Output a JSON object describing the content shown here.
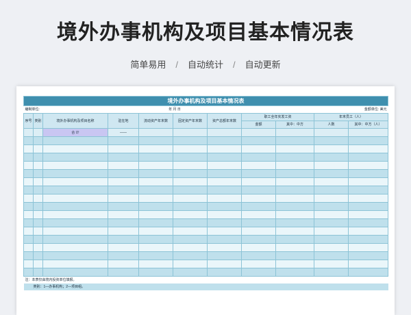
{
  "page": {
    "title": "境外办事机构及项目基本情况表",
    "subtitle_items": [
      "简单易用",
      "自动统计",
      "自动更新"
    ],
    "separator": "/"
  },
  "sheet": {
    "table_title": "境外办事机构及项目基本情况表",
    "unit_label": "编制单位:",
    "date_label": "年 月 日",
    "currency_label": "金额单位: 美元",
    "headers": {
      "seq": "序号",
      "category": "类别",
      "name": "境外办事机构及项目名称",
      "location": "驻在地",
      "current_assets": "流动资产年末数",
      "fixed_assets": "固定资产年末数",
      "total_assets": "资产总额年末数",
      "wage_group": "职工全年实发工资",
      "staff_group": "年末员工（人）",
      "amount": "金额",
      "wage_cn": "其中：中方",
      "people": "人数",
      "staff_cn": "其中：中方（人）"
    },
    "summary": {
      "label": "合 计",
      "location": "——"
    },
    "note_1": "注：本表仅由境内投资单位填报。",
    "note_2": "类别：1—办事机构；2—项目组。"
  },
  "colors": {
    "title_bar": "#3f8fae",
    "row_alt": "#bfe0ec",
    "row_light": "#eaf6fa",
    "summary_label": "#c9c6f2"
  }
}
